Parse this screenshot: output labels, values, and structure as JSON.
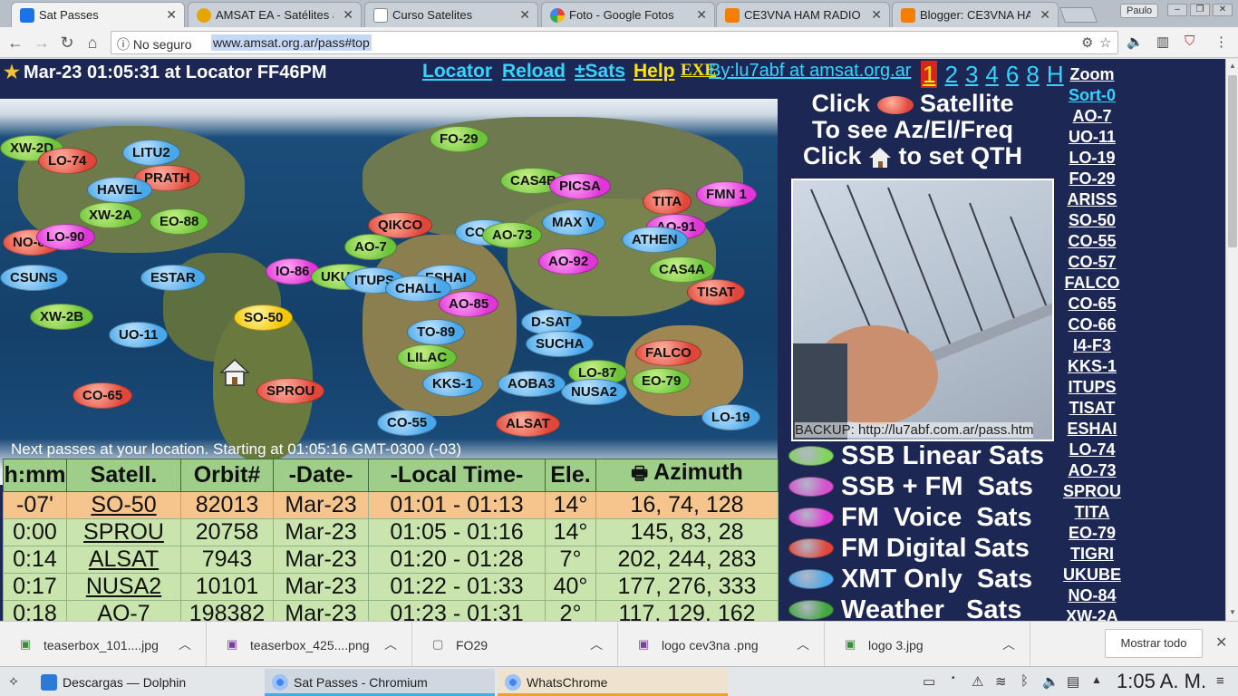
{
  "browser": {
    "tabs": [
      {
        "title": "Sat Passes",
        "active": true
      },
      {
        "title": "AMSAT EA - Satélites a",
        "active": false
      },
      {
        "title": "Curso Satelites",
        "active": false
      },
      {
        "title": "Foto - Google Fotos",
        "active": false
      },
      {
        "title": "CE3VNA HAM RADIO A",
        "active": false
      },
      {
        "title": "Blogger: CE3VNA HAM",
        "active": false
      }
    ],
    "profile": "Paulo",
    "security_label": "No seguro",
    "url": "www.amsat.org.ar/pass#top"
  },
  "page": {
    "header_time": "Mar-23 01:05:31  at Locator FF46PM",
    "links": {
      "locator": "Locator",
      "reload": "Reload",
      "sats": "±Sats",
      "help": "Help",
      "exe": "EXE",
      "by": "By:lu7abf at amsat.org.ar"
    },
    "page_numbers": [
      "1",
      "2",
      "3",
      "4",
      "6",
      "8",
      "H"
    ],
    "current_page": "1",
    "map_sats": [
      {
        "name": "XW-2D",
        "color": "green"
      },
      {
        "name": "LO-74",
        "color": "red"
      },
      {
        "name": "LITU2",
        "color": "blue"
      },
      {
        "name": "PRATH",
        "color": "red"
      },
      {
        "name": "HAVEL",
        "color": "blue"
      },
      {
        "name": "XW-2A",
        "color": "green"
      },
      {
        "name": "EO-88",
        "color": "green"
      },
      {
        "name": "NO-84",
        "color": "red"
      },
      {
        "name": "LO-90",
        "color": "pink"
      },
      {
        "name": "CSUNS",
        "color": "blue"
      },
      {
        "name": "ESTAR",
        "color": "blue"
      },
      {
        "name": "XW-2B",
        "color": "green"
      },
      {
        "name": "UO-11",
        "color": "blue"
      },
      {
        "name": "SO-50",
        "color": "yellow"
      },
      {
        "name": "CO-65",
        "color": "red"
      },
      {
        "name": "SPROU",
        "color": "red"
      },
      {
        "name": "FO-29",
        "color": "green"
      },
      {
        "name": "QIKCO",
        "color": "red"
      },
      {
        "name": "AO-7",
        "color": "green"
      },
      {
        "name": "IO-86",
        "color": "pink"
      },
      {
        "name": "UKUBE",
        "color": "green"
      },
      {
        "name": "ITUPS",
        "color": "blue"
      },
      {
        "name": "ESHAI",
        "color": "blue"
      },
      {
        "name": "CHALL",
        "color": "blue"
      },
      {
        "name": "CO-66",
        "color": "blue"
      },
      {
        "name": "AO-73",
        "color": "green"
      },
      {
        "name": "CAS4B",
        "color": "green"
      },
      {
        "name": "PICSA",
        "color": "pink"
      },
      {
        "name": "MAX V",
        "color": "blue"
      },
      {
        "name": "AO-92",
        "color": "pink"
      },
      {
        "name": "AO-85",
        "color": "pink"
      },
      {
        "name": "TO-89",
        "color": "blue"
      },
      {
        "name": "LILAC",
        "color": "green"
      },
      {
        "name": "KKS-1",
        "color": "blue"
      },
      {
        "name": "D-SAT",
        "color": "blue"
      },
      {
        "name": "SUCHA",
        "color": "blue"
      },
      {
        "name": "AOBA3",
        "color": "blue"
      },
      {
        "name": "LO-87",
        "color": "green"
      },
      {
        "name": "NUSA2",
        "color": "blue"
      },
      {
        "name": "EO-79",
        "color": "green"
      },
      {
        "name": "TITA",
        "color": "red"
      },
      {
        "name": "FMN 1",
        "color": "pink"
      },
      {
        "name": "AO-91",
        "color": "pink"
      },
      {
        "name": "ATHEN",
        "color": "blue"
      },
      {
        "name": "CAS4A",
        "color": "green"
      },
      {
        "name": "TISAT",
        "color": "red"
      },
      {
        "name": "FALCO",
        "color": "red"
      },
      {
        "name": "LO-19",
        "color": "blue"
      },
      {
        "name": "CO-55",
        "color": "blue"
      },
      {
        "name": "ALSAT",
        "color": "red"
      }
    ],
    "next_passes": "Next passes at your location. Starting at 01:05:16 GMT-0300 (-03)",
    "table": {
      "headers": [
        "h:mm",
        "Satell.",
        "Orbit#",
        "-Date-",
        "-Local Time-",
        "Ele.",
        "Azimuth"
      ],
      "rows": [
        {
          "hmm": "-07'",
          "sat": "SO-50",
          "orbit": "82013",
          "date": "Mar-23",
          "time": "01:01 - 01:13",
          "ele": "14°",
          "az": "16, 74, 128"
        },
        {
          "hmm": "0:00",
          "sat": "SPROU",
          "orbit": "20758",
          "date": "Mar-23",
          "time": "01:05 - 01:16",
          "ele": "14°",
          "az": "145, 83, 28"
        },
        {
          "hmm": "0:14",
          "sat": "ALSAT",
          "orbit": "7943",
          "date": "Mar-23",
          "time": "01:20 - 01:28",
          "ele": "7°",
          "az": "202, 244, 283"
        },
        {
          "hmm": "0:17",
          "sat": "NUSA2",
          "orbit": "10101",
          "date": "Mar-23",
          "time": "01:22 - 01:33",
          "ele": "40°",
          "az": "177, 276, 333"
        },
        {
          "hmm": "0:18",
          "sat": "AO-7",
          "orbit": "198382",
          "date": "Mar-23",
          "time": "01:23 - 01:31",
          "ele": "2°",
          "az": "117, 129, 162"
        }
      ]
    },
    "click_info": {
      "line1a": "Click",
      "line1b": "Satellite",
      "line2": "To see Az/El/Freq",
      "line3a": "Click",
      "line3b": "to set QTH"
    },
    "photo_caption": "BACKUP: http://lu7abf.com.ar/pass.htm",
    "legend": [
      {
        "label": "SSB Linear Sats",
        "color": "#7fd55a"
      },
      {
        "label": "SSB + FM  Sats",
        "color": "#d54fd0"
      },
      {
        "label": "FM  Voice  Sats",
        "color": "#e23bd8"
      },
      {
        "label": "FM Digital Sats",
        "color": "#e0473a"
      },
      {
        "label": "XMT Only  Sats",
        "color": "#4aa8ea"
      },
      {
        "label": "Weather   Sats",
        "color": "#3ea83a"
      }
    ],
    "sat_list": [
      "Zoom",
      "Sort-0",
      "AO-7",
      "UO-11",
      "LO-19",
      "FO-29",
      "ARISS",
      "SO-50",
      "CO-55",
      "CO-57",
      "FALCO",
      "CO-65",
      "CO-66",
      "I4-F3",
      "KKS-1",
      "ITUPS",
      "TISAT",
      "ESHAI",
      "LO-74",
      "AO-73",
      "SPROU",
      "TITA",
      "EO-79",
      "TIGRI",
      "UKUBE",
      "NO-84",
      "XW-2A"
    ]
  },
  "downloads": {
    "items": [
      {
        "name": "teaserbox_101....jpg"
      },
      {
        "name": "teaserbox_425....png"
      },
      {
        "name": "FO29"
      },
      {
        "name": "logo cev3na .png"
      },
      {
        "name": "logo 3.jpg"
      }
    ],
    "show_all": "Mostrar todo"
  },
  "taskbar": {
    "tasks": [
      {
        "label": "Descargas — Dolphin"
      },
      {
        "label": "Sat Passes - Chromium"
      },
      {
        "label": "WhatsChrome"
      }
    ],
    "clock": "1:05 A. M."
  }
}
